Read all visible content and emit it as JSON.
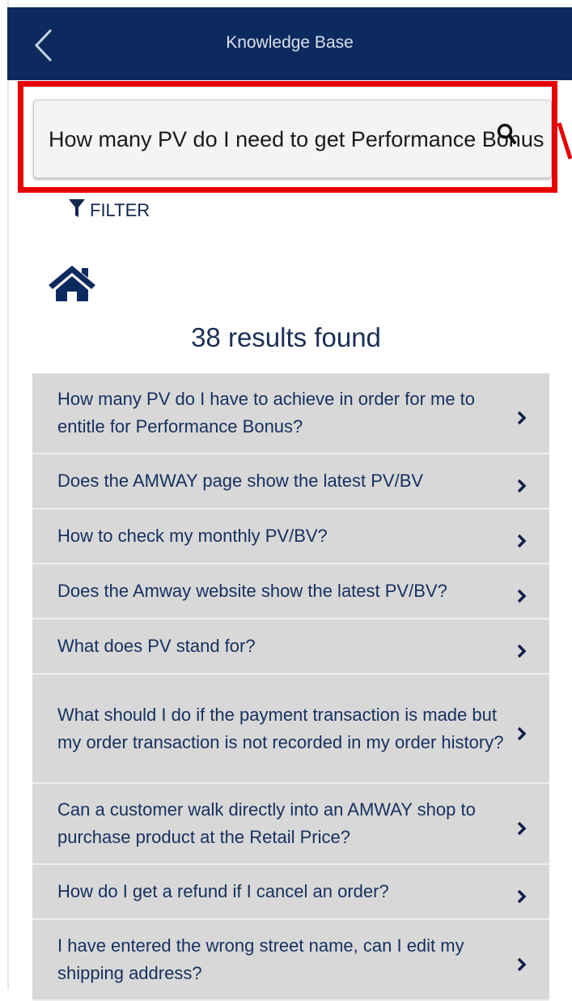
{
  "header": {
    "title": "Knowledge Base",
    "back_icon": "chevron-left-icon",
    "background": "#0c2a5e"
  },
  "search": {
    "value": "How many PV do I need to get Performance Bonus",
    "icon": "search-icon",
    "highlight_color": "#e80000"
  },
  "filter": {
    "label": "FILTER",
    "icon": "filter-icon"
  },
  "home": {
    "icon": "home-icon"
  },
  "results": {
    "count_text": "38 results found",
    "items": [
      {
        "label": "How many PV do I have to achieve in order for me to entitle for Performance Bonus?"
      },
      {
        "label": "Does the AMWAY page show the latest PV/BV"
      },
      {
        "label": "How to check my monthly PV/BV?"
      },
      {
        "label": "Does the Amway website show the latest PV/BV?"
      },
      {
        "label": "What does PV stand for?"
      },
      {
        "label": "What should I do if the payment transaction is made but my order transaction is not recorded in my order history?"
      },
      {
        "label": "Can a customer walk directly into an AMWAY shop to purchase product at the Retail Price?"
      },
      {
        "label": "How do I get a refund if I cancel an order?"
      },
      {
        "label": "I have entered the wrong street name, can I edit my shipping address?"
      }
    ]
  }
}
